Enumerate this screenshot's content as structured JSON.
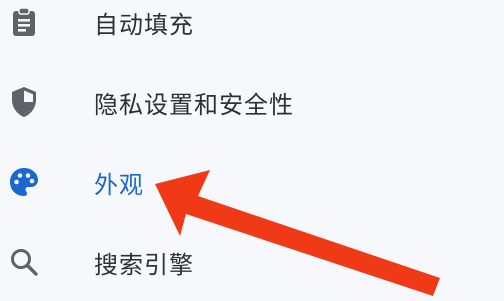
{
  "menu": {
    "items": [
      {
        "label": "自动填充",
        "icon": "clipboard-icon",
        "active": false
      },
      {
        "label": "隐私设置和安全性",
        "icon": "shield-icon",
        "active": false
      },
      {
        "label": "外观",
        "icon": "palette-icon",
        "active": true
      },
      {
        "label": "搜索引擎",
        "icon": "search-icon",
        "active": false
      }
    ]
  },
  "colors": {
    "background": "#f7f8fb",
    "text": "#2f3034",
    "active_text": "#1a66d2",
    "icon_gray": "#5f6368",
    "arrow_red": "#f03a17"
  }
}
